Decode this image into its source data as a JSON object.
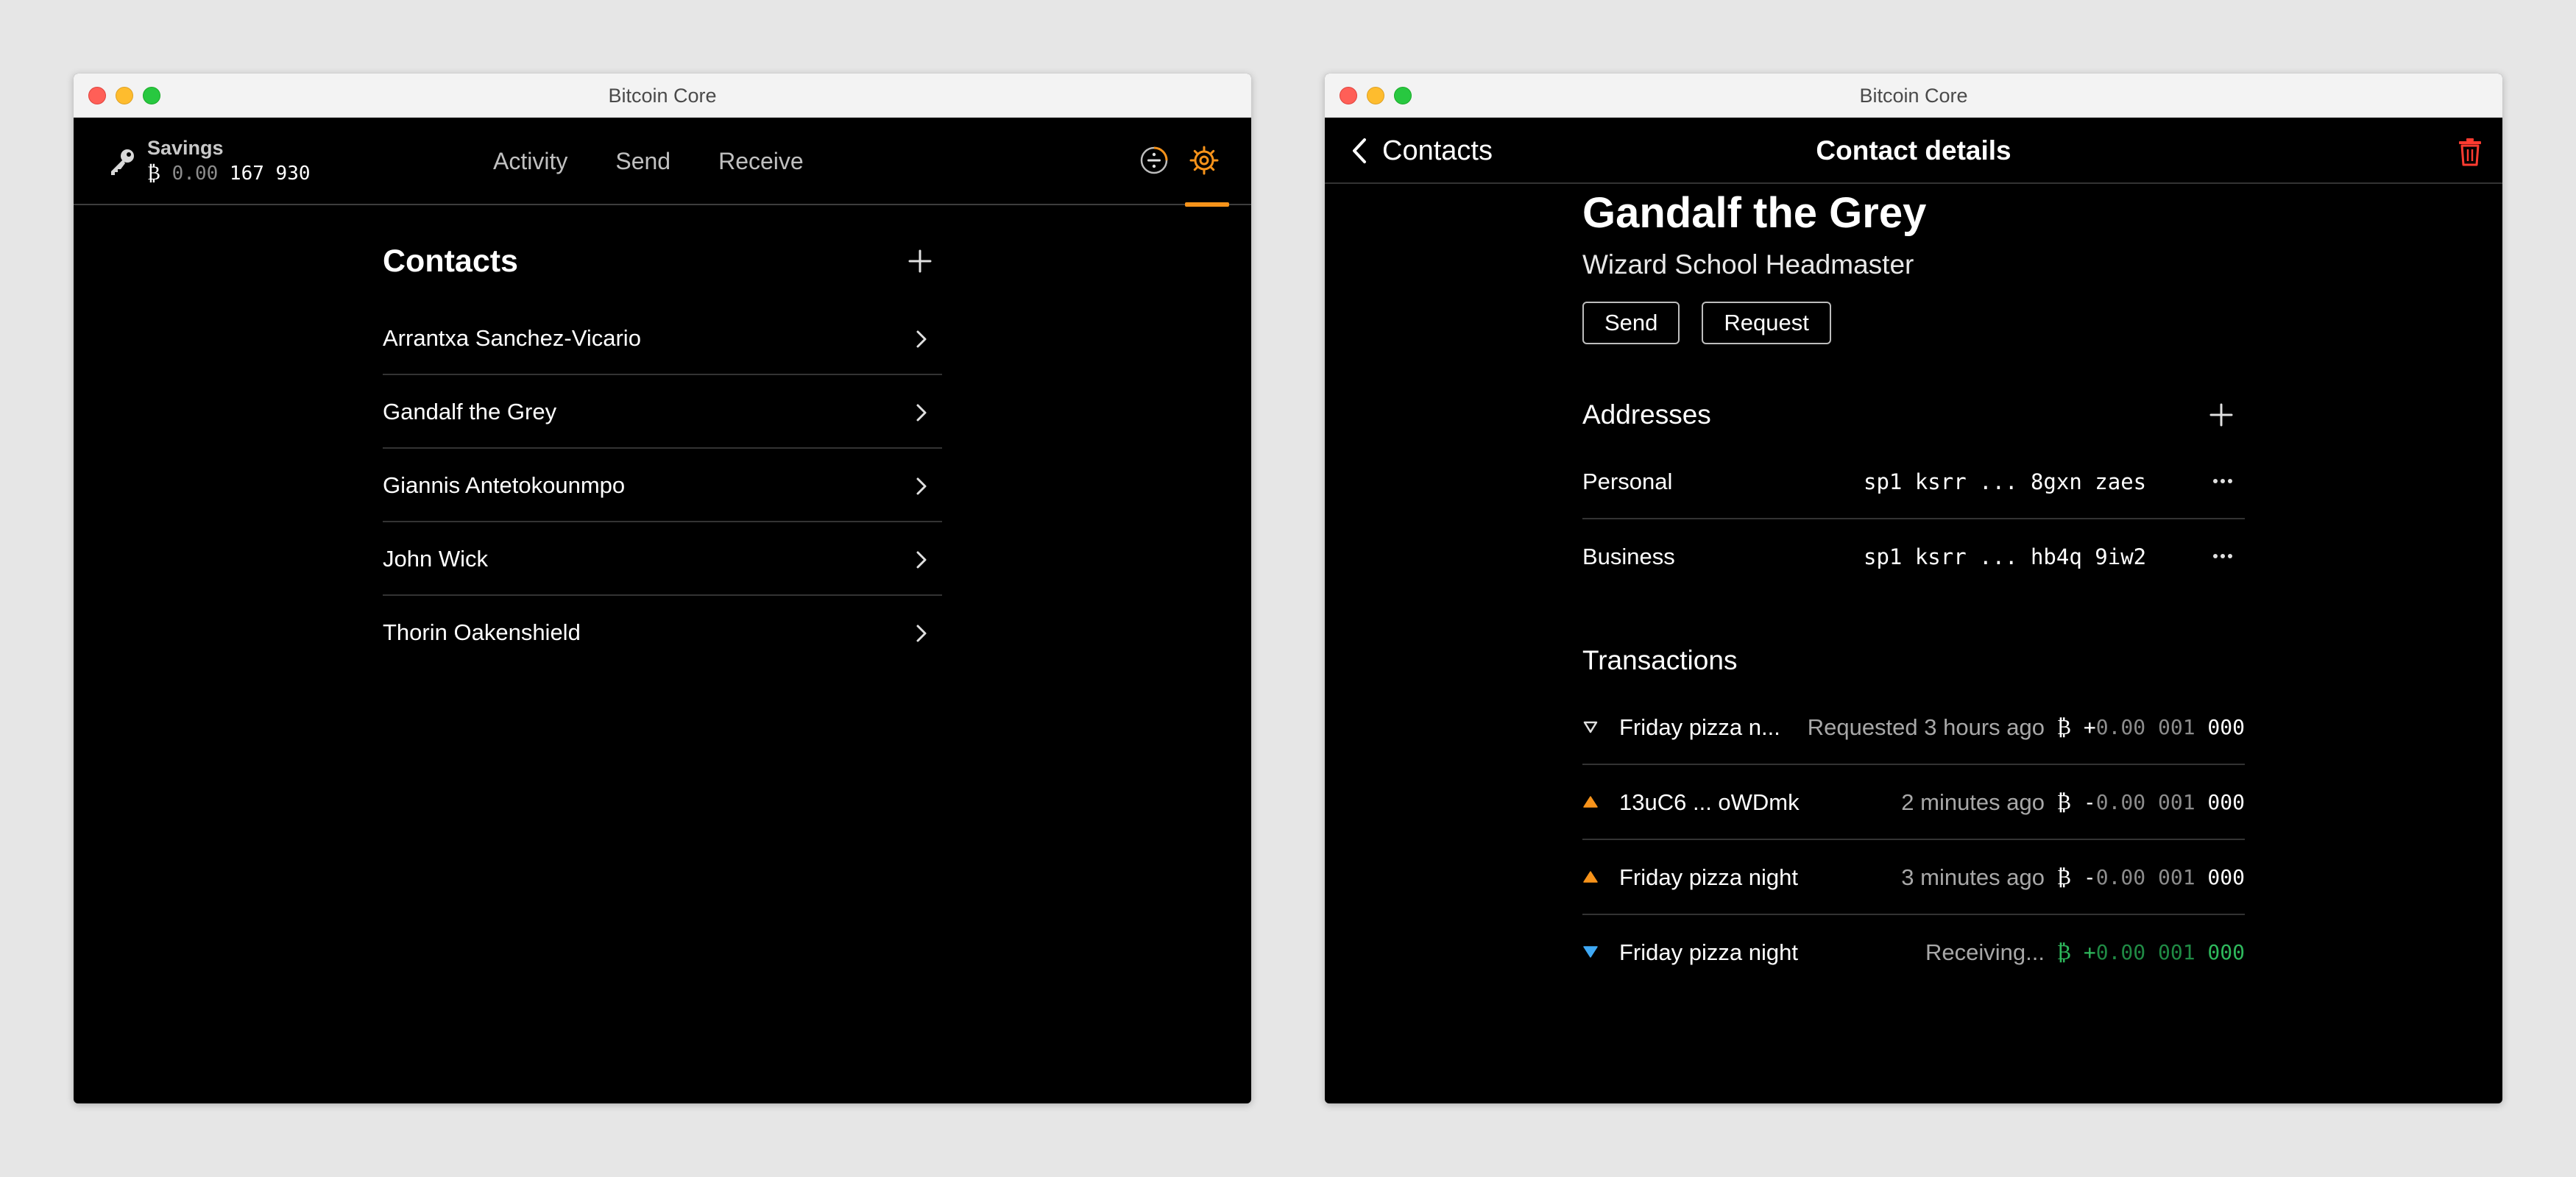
{
  "colors": {
    "accent": "#f7931a",
    "danger": "#ff3b30",
    "receive": "#2eb85c",
    "pending_receive": "#3fa9f5",
    "background": "#000000"
  },
  "left_window": {
    "title": "Bitcoin Core",
    "wallet": {
      "name": "Savings",
      "currency_symbol": "₿",
      "balance_dim": "0.00",
      "balance_main": "167 930",
      "icon": "key-icon"
    },
    "nav": {
      "items": [
        {
          "label": "Activity"
        },
        {
          "label": "Send"
        },
        {
          "label": "Receive"
        }
      ]
    },
    "icons": {
      "block_clock": "block-clock-icon",
      "settings": "gear-icon",
      "active": "settings"
    },
    "contacts": {
      "title": "Contacts",
      "items": [
        {
          "name": "Arrantxa Sanchez-Vicario"
        },
        {
          "name": "Gandalf the Grey"
        },
        {
          "name": "Giannis Antetokounmpo"
        },
        {
          "name": "John Wick"
        },
        {
          "name": "Thorin Oakenshield"
        }
      ]
    }
  },
  "right_window": {
    "title": "Bitcoin Core",
    "header": {
      "back_label": "Contacts",
      "title": "Contact details",
      "delete_icon": "trash-icon"
    },
    "contact": {
      "name": "Gandalf the Grey",
      "subtitle": "Wizard School Headmaster",
      "send_label": "Send",
      "request_label": "Request"
    },
    "addresses": {
      "title": "Addresses",
      "items": [
        {
          "label": "Personal",
          "value": "sp1 ksrr ... 8gxn zaes"
        },
        {
          "label": "Business",
          "value": "sp1 ksrr ... hb4q 9iw2"
        }
      ]
    },
    "transactions": {
      "title": "Transactions",
      "items": [
        {
          "icon": "request-outline-icon",
          "label": "Friday pizza n...",
          "status": "Requested 3 hours ago",
          "symbol": "₿",
          "sign": "+",
          "amount_dim": "0.00 001",
          "amount_main": " 000",
          "tone": "neutral"
        },
        {
          "icon": "sent-triangle-icon",
          "label": "13uC6 ... oWDmk",
          "status": "2 minutes ago",
          "symbol": "₿",
          "sign": "-",
          "amount_dim": "0.00 001",
          "amount_main": " 000",
          "tone": "neutral"
        },
        {
          "icon": "sent-triangle-icon",
          "label": "Friday pizza night",
          "status": "3 minutes ago",
          "symbol": "₿",
          "sign": "-",
          "amount_dim": "0.00 001",
          "amount_main": " 000",
          "tone": "neutral"
        },
        {
          "icon": "receiving-triangle-icon",
          "label": "Friday pizza night",
          "status": "Receiving...",
          "symbol": "₿",
          "sign": "+",
          "amount_dim": "0.00 001",
          "amount_main": " 000",
          "tone": "green"
        }
      ]
    }
  }
}
